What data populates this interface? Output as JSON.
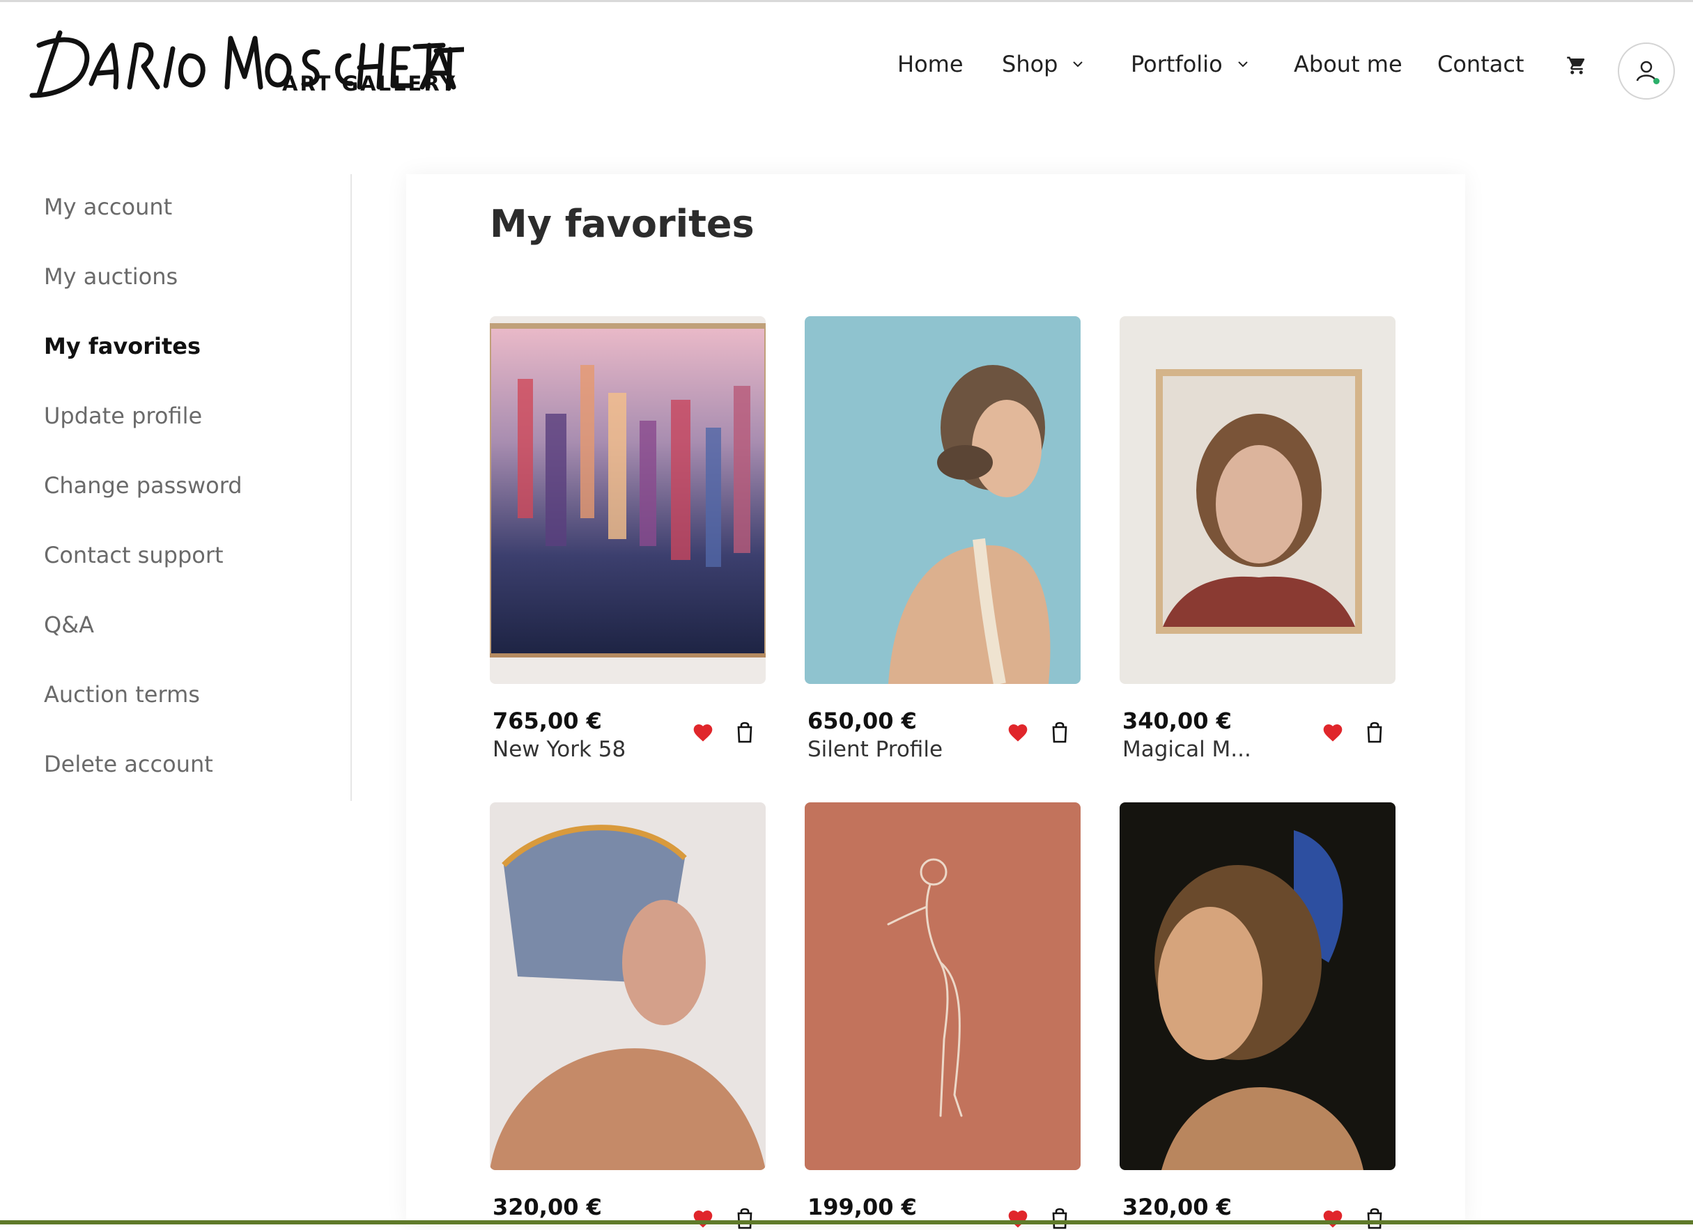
{
  "brand": {
    "script": "Dario Moschetta",
    "subtitle": "ART GALLERY"
  },
  "nav": {
    "items": [
      {
        "label": "Home",
        "has_dropdown": false
      },
      {
        "label": "Shop",
        "has_dropdown": true
      },
      {
        "label": "Portfolio",
        "has_dropdown": true
      },
      {
        "label": "About me",
        "has_dropdown": false
      },
      {
        "label": "Contact",
        "has_dropdown": false
      }
    ],
    "cart_icon": "cart-icon",
    "account_icon": "user-icon",
    "account_status_color": "#2bb06a"
  },
  "sidebar": {
    "items": [
      {
        "label": "My account",
        "active": false
      },
      {
        "label": "My auctions",
        "active": false
      },
      {
        "label": "My favorites",
        "active": true
      },
      {
        "label": "Update profile",
        "active": false
      },
      {
        "label": "Change password",
        "active": false
      },
      {
        "label": "Contact support",
        "active": false
      },
      {
        "label": "Q&A",
        "active": false
      },
      {
        "label": "Auction terms",
        "active": false
      },
      {
        "label": "Delete account",
        "active": false
      }
    ]
  },
  "main": {
    "title": "My favorites",
    "products": [
      {
        "price": "765,00 €",
        "name": "New York 58",
        "favorited": true
      },
      {
        "price": "650,00 €",
        "name": "Silent Profile",
        "favorited": true
      },
      {
        "price": "340,00 €",
        "name": "Magical M...",
        "favorited": true
      },
      {
        "price": "320,00 €",
        "name": "",
        "favorited": true
      },
      {
        "price": "199,00 €",
        "name": "",
        "favorited": true
      },
      {
        "price": "320,00 €",
        "name": "",
        "favorited": true
      }
    ]
  },
  "colors": {
    "accent_heart": "#e0262b",
    "footer_bar": "#5f7a2a"
  }
}
